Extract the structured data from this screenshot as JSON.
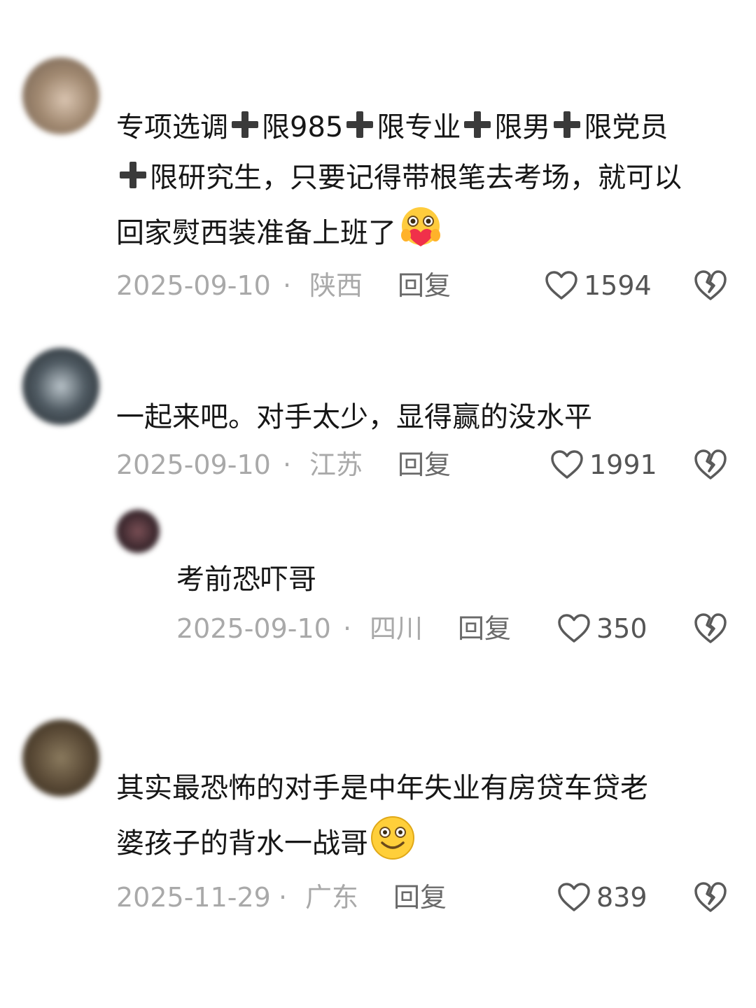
{
  "comments": [
    {
      "text_lines": [
        [
          "专项选调",
          "+",
          "限985",
          "+",
          "限专业",
          "+",
          "限男",
          "+",
          "限党员"
        ],
        [
          "+",
          "限研究生，只要记得带根笔去考场，就可以"
        ],
        [
          "回家熨西装准备上班了"
        ]
      ],
      "emoji": "hug-face-emoji",
      "date": "2025-09-10",
      "separator": "·",
      "location": "陕西",
      "reply_label": "回复",
      "likes": "1594"
    },
    {
      "text_lines": [
        [
          "一起来吧。对手太少，显得赢的没水平"
        ]
      ],
      "date": "2025-09-10",
      "separator": "·",
      "location": "江苏",
      "reply_label": "回复",
      "likes": "1991"
    },
    {
      "text_lines": [
        [
          "考前恐吓哥"
        ]
      ],
      "date": "2025-09-10",
      "separator": "·",
      "location": "四川",
      "reply_label": "回复",
      "likes": "350"
    },
    {
      "text_lines": [
        [
          "其实最恐怖的对手是中年失业有房贷车贷老"
        ],
        [
          "婆孩子的背水一战哥"
        ]
      ],
      "emoji": "smiling-face-emoji",
      "date": "2025-11-29",
      "separator": "·",
      "location": "广东",
      "reply_label": "回复",
      "likes": "839"
    }
  ],
  "icons": {
    "like": "heart-outline-icon",
    "dislike": "broken-heart-icon"
  },
  "colors": {
    "text": "#161616",
    "meta": "#a9a9a9",
    "reply": "#6a6a6a",
    "background": "#ffffff"
  }
}
